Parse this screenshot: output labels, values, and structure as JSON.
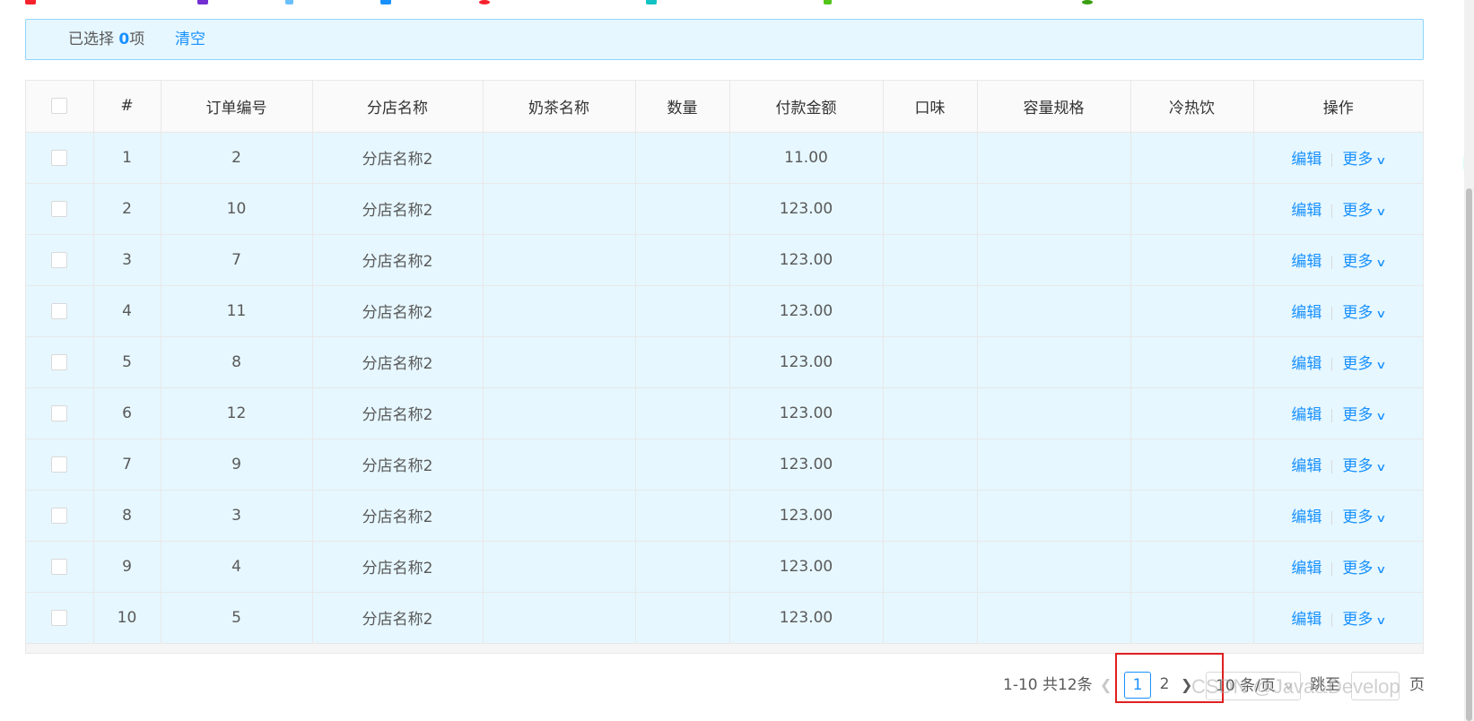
{
  "selection": {
    "prefix": "已选择 ",
    "count": "0",
    "suffix": "项",
    "clear_label": "清空"
  },
  "table": {
    "columns": [
      "#",
      "订单编号",
      "分店名称",
      "奶茶名称",
      "数量",
      "付款金额",
      "口味",
      "容量规格",
      "冷热饮",
      "操作"
    ],
    "rows": [
      {
        "index": "1",
        "order_no": "2",
        "store": "分店名称2",
        "tea": "",
        "qty": "",
        "amount": "11.00",
        "taste": "",
        "size": "",
        "temp": ""
      },
      {
        "index": "2",
        "order_no": "10",
        "store": "分店名称2",
        "tea": "",
        "qty": "",
        "amount": "123.00",
        "taste": "",
        "size": "",
        "temp": ""
      },
      {
        "index": "3",
        "order_no": "7",
        "store": "分店名称2",
        "tea": "",
        "qty": "",
        "amount": "123.00",
        "taste": "",
        "size": "",
        "temp": ""
      },
      {
        "index": "4",
        "order_no": "11",
        "store": "分店名称2",
        "tea": "",
        "qty": "",
        "amount": "123.00",
        "taste": "",
        "size": "",
        "temp": ""
      },
      {
        "index": "5",
        "order_no": "8",
        "store": "分店名称2",
        "tea": "",
        "qty": "",
        "amount": "123.00",
        "taste": "",
        "size": "",
        "temp": ""
      },
      {
        "index": "6",
        "order_no": "12",
        "store": "分店名称2",
        "tea": "",
        "qty": "",
        "amount": "123.00",
        "taste": "",
        "size": "",
        "temp": ""
      },
      {
        "index": "7",
        "order_no": "9",
        "store": "分店名称2",
        "tea": "",
        "qty": "",
        "amount": "123.00",
        "taste": "",
        "size": "",
        "temp": ""
      },
      {
        "index": "8",
        "order_no": "3",
        "store": "分店名称2",
        "tea": "",
        "qty": "",
        "amount": "123.00",
        "taste": "",
        "size": "",
        "temp": ""
      },
      {
        "index": "9",
        "order_no": "4",
        "store": "分店名称2",
        "tea": "",
        "qty": "",
        "amount": "123.00",
        "taste": "",
        "size": "",
        "temp": ""
      },
      {
        "index": "10",
        "order_no": "5",
        "store": "分店名称2",
        "tea": "",
        "qty": "",
        "amount": "123.00",
        "taste": "",
        "size": "",
        "temp": ""
      }
    ],
    "actions": {
      "edit": "编辑",
      "more": "更多",
      "more_icon": "chevron-down-icon"
    }
  },
  "pagination": {
    "total_text": "1-10 共12条",
    "pages": [
      "1",
      "2"
    ],
    "current_page": "1",
    "page_size": "10 条/页",
    "jump_label": "跳至",
    "page_label": "页"
  },
  "watermark": "CSDN @Java&Develop",
  "colors": {
    "accent": "#1890ff",
    "row_selected_bg": "#e6f7ff",
    "highlight_box": "#e02020"
  }
}
